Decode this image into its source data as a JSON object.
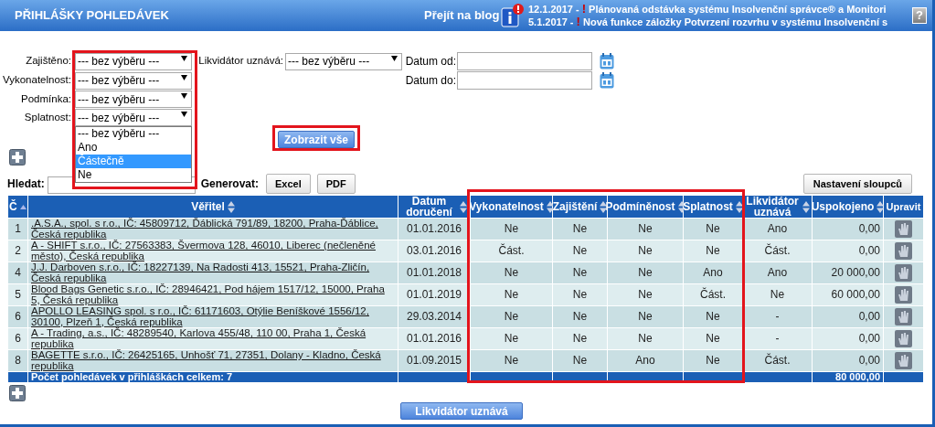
{
  "header": {
    "title": "PŘIHLÁŠKY POHLEDÁVEK",
    "blog_link": "Přejít na blog",
    "help": "?",
    "news": [
      {
        "date": "12.1.2017",
        "sep": " - ",
        "alert": "!",
        "text": "Plánovaná odstávka systému Insolvenční správce® a Monitori"
      },
      {
        "date": "5.1.2017",
        "sep": " - ",
        "alert": "!",
        "text": "Nová funkce záložky Potvrzení rozvrhu v systému Insolvenční s"
      }
    ]
  },
  "filters": [
    {
      "label": "Zajištěno:",
      "value": "--- bez výběru ---"
    },
    {
      "label": "Vykonatelnost:",
      "value": "--- bez výběru ---"
    },
    {
      "label": "Podmínka:",
      "value": "--- bez výběru ---"
    },
    {
      "label": "Splatnost:",
      "value": "--- bez výběru ---"
    }
  ],
  "liquidator_filter": {
    "label": "Likvidátor uznává:",
    "value": "--- bez výběru ---"
  },
  "date_from": {
    "label": "Datum od:"
  },
  "date_to": {
    "label": "Datum do:"
  },
  "open_dropdown": {
    "options": [
      {
        "label": "--- bez výběru ---",
        "selected": false
      },
      {
        "label": "Ano",
        "selected": false
      },
      {
        "label": "Částečně",
        "selected": true
      },
      {
        "label": "Ne",
        "selected": false
      }
    ]
  },
  "show_all_button": "Zobrazit vše",
  "search": {
    "label": "Hledat:"
  },
  "generate": {
    "label": "Generovat:",
    "buttons": [
      "Excel",
      "PDF"
    ]
  },
  "columns_button": "Nastavení sloupců",
  "table": {
    "columns": [
      {
        "label": "Č",
        "sortable": true,
        "sorted": true
      },
      {
        "label": "Věřitel",
        "sortable": true,
        "sorted": false
      },
      {
        "label": "Datum doručení",
        "sortable": true,
        "sorted": false
      },
      {
        "label": "Vykonatelnost",
        "sortable": true,
        "sorted": false
      },
      {
        "label": "Zajištění",
        "sortable": true,
        "sorted": false
      },
      {
        "label": "Podmíněnost",
        "sortable": true,
        "sorted": false
      },
      {
        "label": "Splatnost",
        "sortable": true,
        "sorted": false
      },
      {
        "label": "Likvidátor uznává",
        "sortable": true,
        "sorted": false
      },
      {
        "label": "Uspokojeno",
        "sortable": true,
        "sorted": false
      },
      {
        "label": "Upravit",
        "sortable": false
      }
    ],
    "rows": [
      {
        "cells": [
          "1",
          ".A.S.A., spol. s r.o., IČ: 45809712, Ďáblická 791/89, 18200, Praha-Ďáblice, Česká republika",
          "01.01.2016",
          "Ne",
          "Ne",
          "Ne",
          "Ne",
          "Ano",
          "0,00"
        ]
      },
      {
        "cells": [
          "2",
          "A - SHIFT s.r.o., IČ: 27563383, Švermova 128, 46010, Liberec (nečleněné město), Česká republika",
          "03.01.2016",
          "Část.",
          "Ne",
          "Ne",
          "Ne",
          "Část.",
          "0,00"
        ]
      },
      {
        "cells": [
          "4",
          "J.J. Darboven s.r.o., IČ: 18227139, Na Radosti 413, 15521, Praha-Zličín, Česká republika",
          "01.01.2018",
          "Ne",
          "Ne",
          "Ne",
          "Ano",
          "Ano",
          "20 000,00"
        ]
      },
      {
        "cells": [
          "5",
          "Blood Bags Genetic s.r.o., IČ: 28946421, Pod hájem 1517/12, 15000, Praha 5, Česká republika",
          "01.01.2019",
          "Ne",
          "Ne",
          "Ne",
          "Část.",
          "Ne",
          "60 000,00"
        ]
      },
      {
        "cells": [
          "6",
          "APOLLO LEASING spol. s r.o., IČ: 61171603, Otýlie Beníškové 1556/12, 30100, Plzeň 1, Česká republika",
          "29.03.2014",
          "Ne",
          "Ne",
          "Ne",
          "Ne",
          "-",
          "0,00"
        ]
      },
      {
        "cells": [
          "6",
          "A - Trading, a.s., IČ: 48289540, Karlova 455/48, 110 00, Praha 1, Česká republika",
          "01.01.2016",
          "Ne",
          "Ne",
          "Ne",
          "Ne",
          "-",
          "0,00"
        ]
      },
      {
        "cells": [
          "8",
          "BAGETTE s.r.o., IČ: 26425165, Unhošť 71, 27351, Dolany - Kladno, Česká republika",
          "01.09.2015",
          "Ne",
          "Ne",
          "Ano",
          "Ne",
          "Část.",
          "0,00"
        ]
      }
    ],
    "footer": {
      "label": "Počet pohledávek v přihláškách celkem: 7",
      "total": "80 000,00"
    }
  },
  "bottom_button": "Likvidátor uznává"
}
